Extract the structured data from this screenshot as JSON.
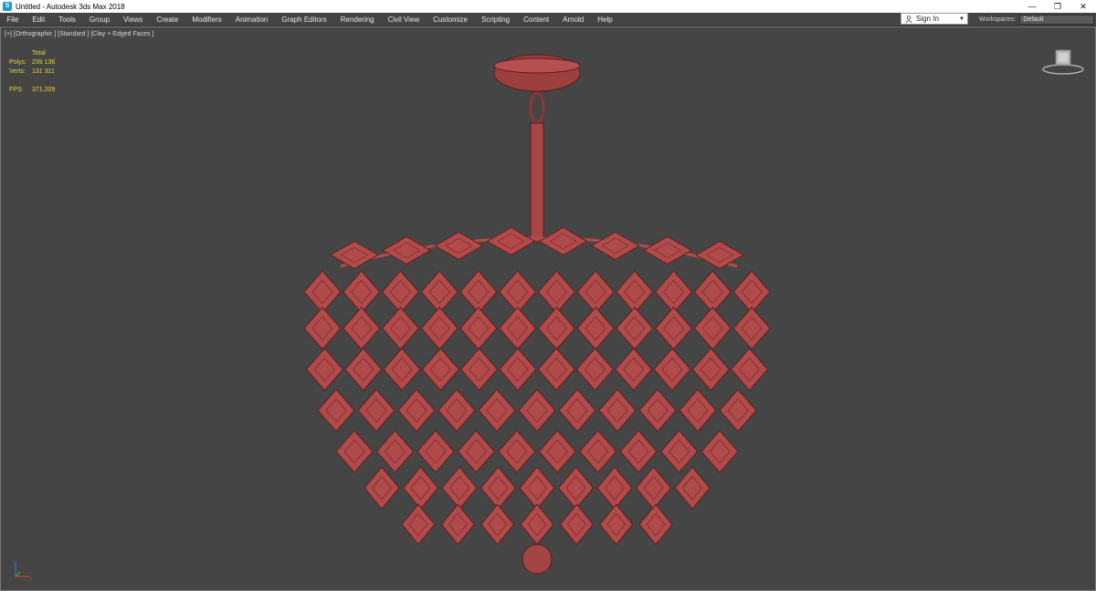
{
  "window": {
    "title": "Untitled - Autodesk 3ds Max 2018",
    "icon": "3dsmax-app-icon",
    "controls": {
      "minimize": "—",
      "restore": "❐",
      "close": "✕"
    }
  },
  "menu": {
    "items": [
      "File",
      "Edit",
      "Tools",
      "Group",
      "Views",
      "Create",
      "Modifiers",
      "Animation",
      "Graph Editors",
      "Rendering",
      "Civil View",
      "Customize",
      "Scripting",
      "Content",
      "Arnold",
      "Help"
    ]
  },
  "signin": {
    "label": "Sign In",
    "icon": "user-icon"
  },
  "workspaces": {
    "label": "Workspaces:",
    "value": "Default"
  },
  "viewport": {
    "label": "[+] [Orthographic ] [Standard ] [Clay + Edged Faces ]",
    "stats": {
      "header": "Total",
      "polys_label": "Polys:",
      "polys": "239 136",
      "verts_label": "Verts:",
      "verts": "131 311",
      "fps_label": "FPS:",
      "fps": "371,209"
    }
  },
  "colors": {
    "background": "#454545",
    "model": "#b14a4a",
    "stats_text": "#e6d437"
  }
}
